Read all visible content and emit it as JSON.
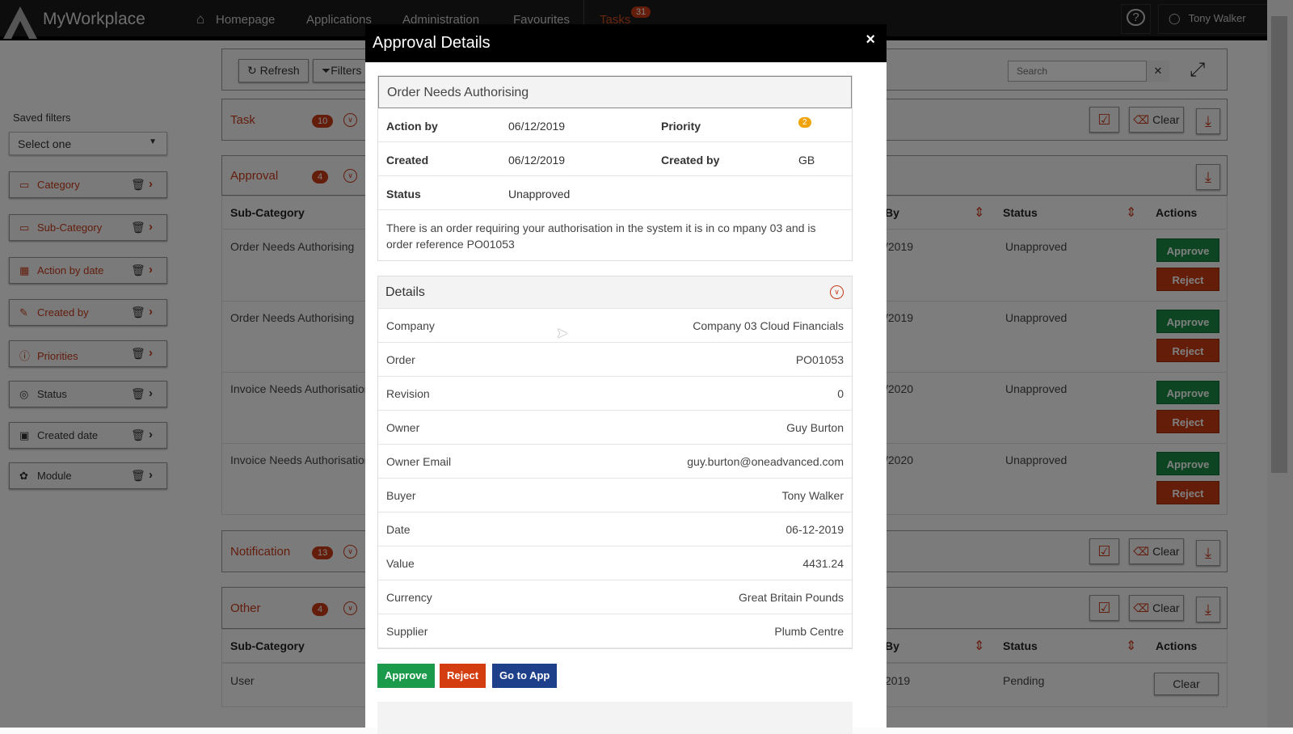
{
  "nav": {
    "brand": "MyWorkplace",
    "items": [
      "Homepage",
      "Applications",
      "Administration",
      "Favourites",
      "Tasks"
    ],
    "tasks_count": "31",
    "user": "Tony Walker"
  },
  "sidebar": {
    "saved_filters_label": "Saved filters",
    "select_value": "Select one",
    "filters": [
      {
        "label": "Category",
        "icon": "category-icon",
        "active": true
      },
      {
        "label": "Sub-Category",
        "icon": "subcategory-icon",
        "active": true
      },
      {
        "label": "Action by date",
        "icon": "calendar-icon",
        "active": true
      },
      {
        "label": "Created by",
        "icon": "edit-icon",
        "active": true
      },
      {
        "label": "Priorities",
        "icon": "alert-icon",
        "active": true
      },
      {
        "label": "Status",
        "icon": "status-icon",
        "active": false
      },
      {
        "label": "Created date",
        "icon": "calendar-plus-icon",
        "active": false
      },
      {
        "label": "Module",
        "icon": "module-icon",
        "active": false
      }
    ]
  },
  "toolbar": {
    "refresh": "Refresh",
    "filters": "Filters",
    "search_placeholder": "Search"
  },
  "sections": {
    "task": {
      "label": "Task",
      "count": "10"
    },
    "approval": {
      "label": "Approval",
      "count": "4"
    },
    "notification": {
      "label": "Notification",
      "count": "13"
    },
    "other": {
      "label": "Other",
      "count": "4"
    },
    "clear": "Clear"
  },
  "table": {
    "headers": {
      "subcategory": "Sub-Category",
      "by": "By",
      "status": "Status",
      "actions": "Actions"
    },
    "approval_rows": [
      {
        "sub": "Order Needs Authorising",
        "date": "/2019",
        "status": "Unapproved"
      },
      {
        "sub": "Order Needs Authorising",
        "date": "/2019",
        "status": "Unapproved"
      },
      {
        "sub": "Invoice Needs Authorisation",
        "date": "/2020",
        "status": "Unapproved"
      },
      {
        "sub": "Invoice Needs Authorisation",
        "date": "/2020",
        "status": "Unapproved"
      }
    ],
    "approve": "Approve",
    "reject": "Reject",
    "other_rows": [
      {
        "sub": "User",
        "date": "2019",
        "status": "Pending",
        "action": "Clear"
      }
    ]
  },
  "modal": {
    "title": "Approval Details",
    "close": "×",
    "card_title": "Order Needs Authorising",
    "action_by_label": "Action by",
    "action_by": "06/12/2019",
    "priority_label": "Priority",
    "priority": "2",
    "created_label": "Created",
    "created": "06/12/2019",
    "created_by_label": "Created by",
    "created_by": "GB",
    "status_label": "Status",
    "status": "Unapproved",
    "description": "There is an order requiring your authorisation in the system it is in co mpany 03 and is order reference PO01053",
    "details_title": "Details",
    "details": [
      {
        "k": "Company",
        "v": "Company 03 Cloud Financials"
      },
      {
        "k": "Order",
        "v": "PO01053"
      },
      {
        "k": "Revision",
        "v": "0"
      },
      {
        "k": "Owner",
        "v": "Guy Burton"
      },
      {
        "k": "Owner Email",
        "v": "guy.burton@oneadvanced.com"
      },
      {
        "k": "Buyer",
        "v": "Tony Walker"
      },
      {
        "k": "Date",
        "v": "06-12-2019"
      },
      {
        "k": "Value",
        "v": "4431.24"
      },
      {
        "k": "Currency",
        "v": "Great Britain Pounds"
      },
      {
        "k": "Supplier",
        "v": "Plumb Centre"
      }
    ],
    "approve": "Approve",
    "reject": "Reject",
    "go_to_app": "Go to App"
  },
  "colors": {
    "accent": "#c63a1a",
    "approve": "#1a8a45",
    "reject": "#c93a12",
    "goto": "#1e3f8a",
    "priority": "#f0a30a"
  }
}
